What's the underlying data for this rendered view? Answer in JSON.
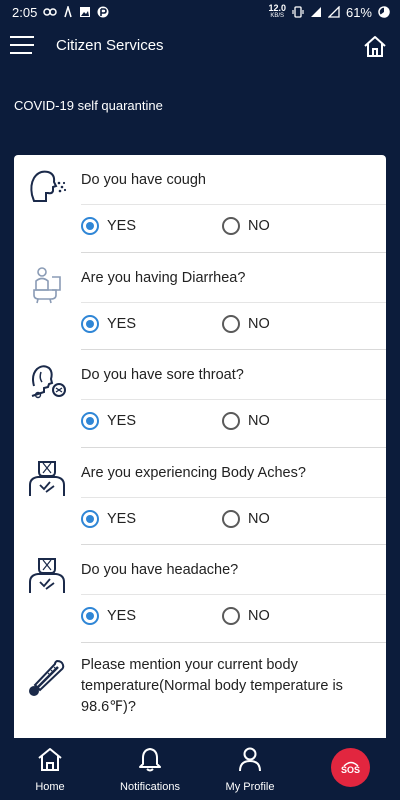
{
  "status_bar": {
    "time": "2:05",
    "speed_value": "12.0",
    "speed_unit": "KB/S",
    "battery": "61%"
  },
  "header": {
    "title": "Citizen Services"
  },
  "page": {
    "subtitle": "COVID-19 self quarantine"
  },
  "questions": [
    {
      "text": "Do you have cough",
      "icon": "cough-icon",
      "selected": "YES"
    },
    {
      "text": "Are you having Diarrhea?",
      "icon": "diarrhea-icon",
      "selected": "YES"
    },
    {
      "text": "Do you have sore throat?",
      "icon": "sore-throat-icon",
      "selected": "YES"
    },
    {
      "text": "Are you experiencing Body Aches?",
      "icon": "body-aches-icon",
      "selected": "YES"
    },
    {
      "text": "Do you have headache?",
      "icon": "headache-icon",
      "selected": "YES"
    }
  ],
  "options": {
    "yes": "YES",
    "no": "NO"
  },
  "temperature_question": "Please mention your current body temperature(Normal body temperature is 98.6℉)?",
  "bottom_nav": {
    "home": "Home",
    "notifications": "Notifications",
    "profile": "My Profile",
    "sos": "SOS"
  },
  "colors": {
    "background": "#0c1c3b",
    "accent": "#2f86d6",
    "sos": "#e2263f",
    "icon_navy": "#1b2a4a"
  }
}
